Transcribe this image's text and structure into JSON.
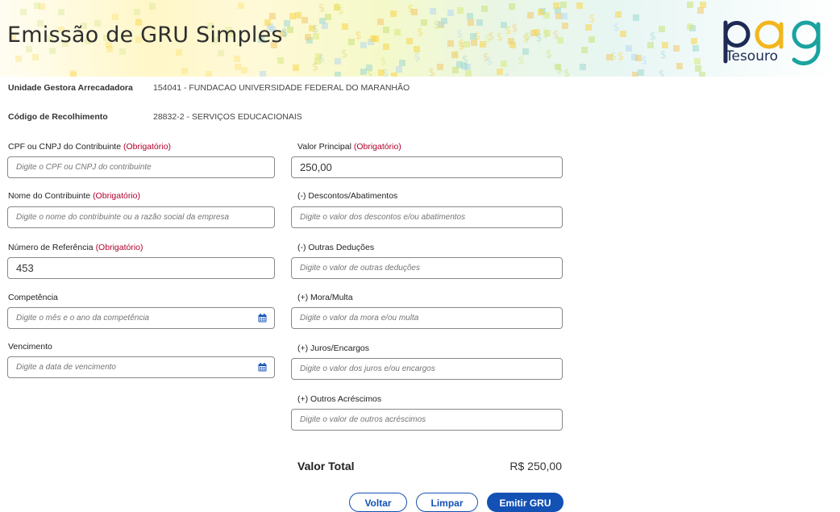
{
  "header": {
    "title": "Emissão de GRU Simples",
    "logo_text": "pag",
    "logo_sub": "Tesouro"
  },
  "info": {
    "ug_label": "Unidade Gestora Arrecadadora",
    "ug_value": "154041 - FUNDACAO UNIVERSIDADE FEDERAL DO MARANHÃO",
    "codigo_label": "Código de Recolhimento",
    "codigo_value": "28832-2 - SERVIÇOS EDUCACIONAIS"
  },
  "required_tag": "(Obrigatório)",
  "fields": {
    "cpf": {
      "label": "CPF ou CNPJ do Contribuinte",
      "placeholder": "Digite o CPF ou CNPJ do contribuinte",
      "value": ""
    },
    "nome": {
      "label": "Nome do Contribuinte",
      "placeholder": "Digite o nome do contribuinte ou a razão social da empresa",
      "value": ""
    },
    "referencia": {
      "label": "Número de Referência",
      "placeholder": "",
      "value": "453"
    },
    "competencia": {
      "label": "Competência",
      "placeholder": "Digite o mês e o ano da competência",
      "value": ""
    },
    "vencimento": {
      "label": "Vencimento",
      "placeholder": "Digite a data de vencimento",
      "value": ""
    },
    "valor_principal": {
      "label": "Valor Principal",
      "placeholder": "",
      "value": "250,00"
    },
    "descontos": {
      "label": "(-) Descontos/Abatimentos",
      "placeholder": "Digite o valor dos descontos e/ou abatimentos",
      "value": ""
    },
    "deducoes": {
      "label": "(-) Outras Deduções",
      "placeholder": "Digite o valor de outras deduções",
      "value": ""
    },
    "mora": {
      "label": "(+) Mora/Multa",
      "placeholder": "Digite o valor da mora e/ou multa",
      "value": ""
    },
    "juros": {
      "label": "(+) Juros/Encargos",
      "placeholder": "Digite o valor dos juros e/ou encargos",
      "value": ""
    },
    "acrescimos": {
      "label": "(+) Outros Acréscimos",
      "placeholder": "Digite o valor de outros acréscimos",
      "value": ""
    }
  },
  "total": {
    "label": "Valor Total",
    "value": "R$ 250,00"
  },
  "buttons": {
    "voltar": "Voltar",
    "limpar": "Limpar",
    "emitir": "Emitir GRU"
  },
  "icons": {
    "calendar": "calendar-icon"
  },
  "colors": {
    "primary": "#1451b4",
    "required": "#b0002a",
    "logo_blue": "#1e2a55",
    "logo_teal": "#1aa3a0"
  }
}
